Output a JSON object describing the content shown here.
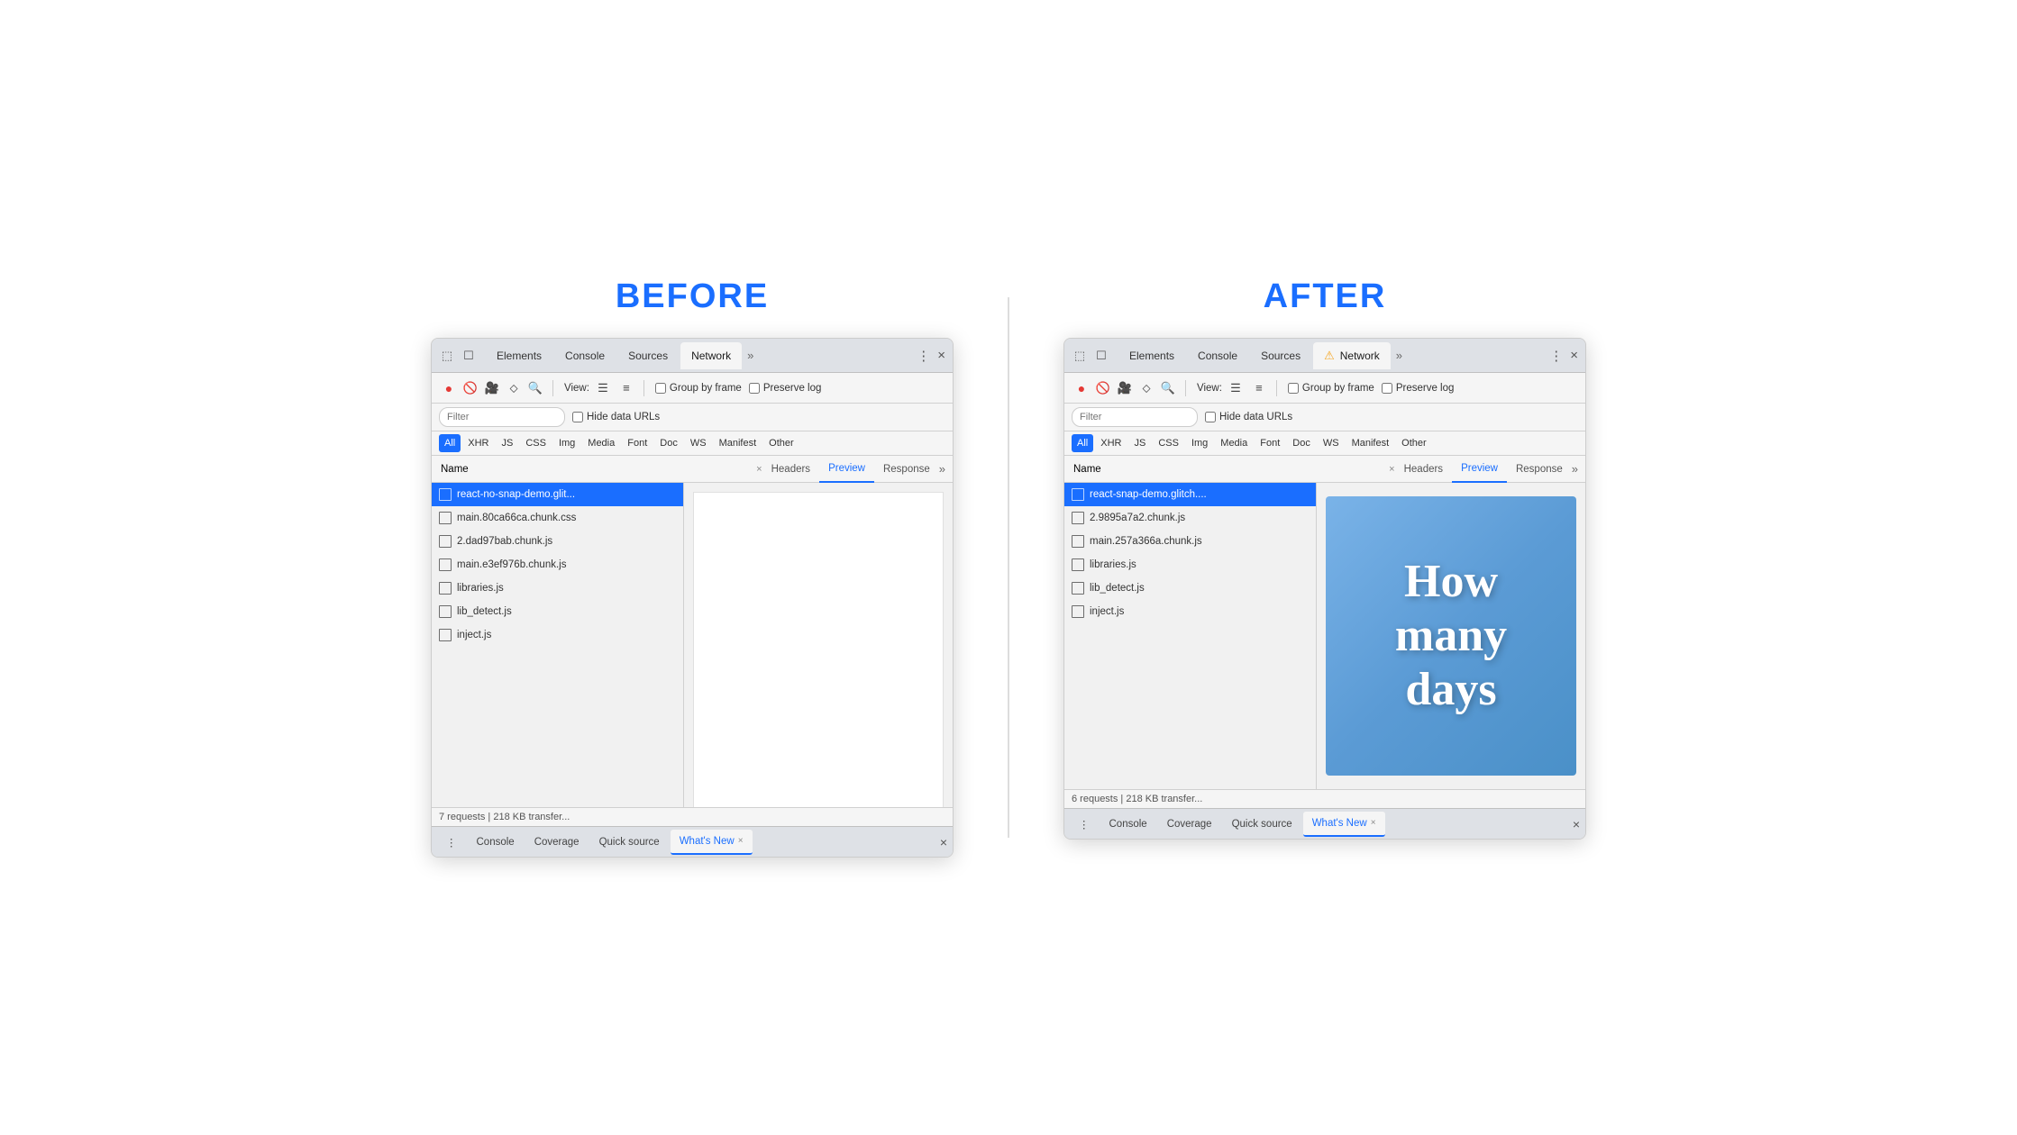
{
  "before_label": "BEFORE",
  "after_label": "AFTER",
  "devtools": {
    "tabs": [
      "Elements",
      "Console",
      "Sources",
      "Network"
    ],
    "active_tab": "Network",
    "more_tabs": "»",
    "menu_icon": "⋮",
    "close_icon": "×",
    "toolbar": {
      "record_btn": "●",
      "stop_btn": "🚫",
      "camera_icon": "📷",
      "filter_icon": "⬦",
      "search_icon": "🔍",
      "view_label": "View:",
      "list_icon": "☰",
      "small_list_icon": "≡",
      "group_by_frame_label": "Group by frame",
      "preserve_log_label": "Preserve log"
    },
    "filter_placeholder": "Filter",
    "hide_data_urls_label": "Hide data URLs",
    "resource_types": [
      "All",
      "XHR",
      "JS",
      "CSS",
      "Img",
      "Media",
      "Font",
      "Doc",
      "WS",
      "Manifest",
      "Other"
    ],
    "active_resource": "All",
    "col_headers": {
      "name": "Name",
      "close": "×",
      "headers": "Headers",
      "preview": "Preview",
      "response": "Response",
      "more": "»"
    },
    "bottom_tabs": [
      "Console",
      "Coverage",
      "Quick source",
      "What's New"
    ],
    "active_bottom_tab": "What's New"
  },
  "before": {
    "files": [
      "react-no-snap-demo.glit...",
      "main.80ca66ca.chunk.css",
      "2.dad97bab.chunk.js",
      "main.e3ef976b.chunk.js",
      "libraries.js",
      "lib_detect.js",
      "inject.js"
    ],
    "selected_file": 0,
    "status": "7 requests | 218 KB transfer...",
    "preview": "empty"
  },
  "after": {
    "files": [
      "react-snap-demo.glitch....",
      "2.9895a7a2.chunk.js",
      "main.257a366a.chunk.js",
      "libraries.js",
      "lib_detect.js",
      "inject.js"
    ],
    "selected_file": 0,
    "status": "6 requests | 218 KB transfer...",
    "preview": "image",
    "preview_text": [
      "How",
      "many",
      "days"
    ]
  }
}
